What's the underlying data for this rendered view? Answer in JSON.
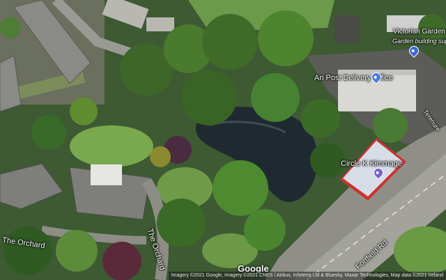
{
  "map": {
    "imagery": "satellite",
    "labels": {
      "victorian_garden": "Victorian Garden Buildings",
      "victorian_garden_sub": "Garden building supplier",
      "an_post": "An Post Delivery Office",
      "circle_k": "Circle K Kimmage",
      "fortfield_rd": "Fortfield Rd",
      "the_orchard_1": "The Orchard",
      "the_orchard_2": "The Orchard",
      "terenure": "Terenure"
    },
    "branding": "Google",
    "attribution": "Imagery ©2021 Google, Imagery ©2021 CNES / Airbus, Infoterra Ltd & Bluesky, Maxar Technologies, Map data ©2021   Ireland",
    "colors": {
      "poi_blue": "#4a7fd8",
      "poi_shop_blue": "#3b6bd0",
      "fuel_purple": "#7b5fd0"
    },
    "icons": {
      "an_post": "building-pin-icon",
      "victorian": "shopping-pin-icon",
      "circle_k": "fuel-pin-icon"
    }
  }
}
